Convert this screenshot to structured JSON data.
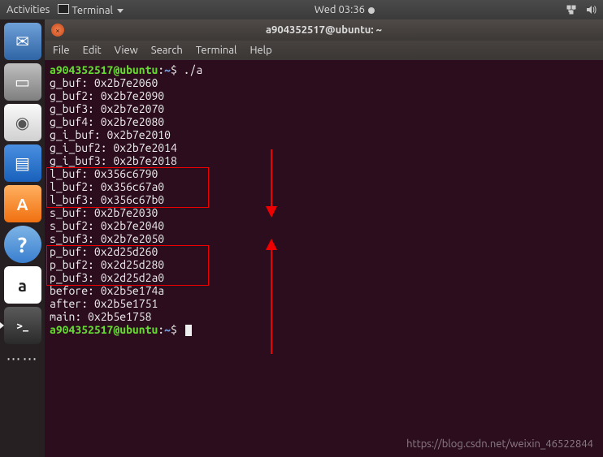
{
  "topbar": {
    "activities": "Activities",
    "app_label": "Terminal",
    "clock": "Wed 03:36"
  },
  "launcher": {
    "items": [
      {
        "name": "thunderbird-icon",
        "glyph": "✉"
      },
      {
        "name": "files-icon",
        "glyph": "▭"
      },
      {
        "name": "rhythmbox-icon",
        "glyph": "◉"
      },
      {
        "name": "libreoffice-writer-icon",
        "glyph": "▤"
      },
      {
        "name": "ubuntu-software-icon",
        "glyph": "A"
      },
      {
        "name": "help-icon",
        "glyph": "?"
      },
      {
        "name": "amazon-icon",
        "glyph": "a"
      },
      {
        "name": "terminal-icon",
        "glyph": ">_"
      }
    ]
  },
  "window": {
    "title": "a904352517@ubuntu: ~",
    "menus": [
      "File",
      "Edit",
      "View",
      "Search",
      "Terminal",
      "Help"
    ]
  },
  "prompt": {
    "user_host": "a904352517@ubuntu",
    "sep1": ":",
    "path": "~",
    "sep2": "$ "
  },
  "cmd": "./a",
  "output": [
    "g_buf: 0x2b7e2060",
    "g_buf2: 0x2b7e2090",
    "g_buf3: 0x2b7e2070",
    "g_buf4: 0x2b7e2080",
    "g_i_buf: 0x2b7e2010",
    "g_i_buf2: 0x2b7e2014",
    "g_i_buf3: 0x2b7e2018",
    "l_buf: 0x356c6790",
    "l_buf2: 0x356c67a0",
    "l_buf3: 0x356c67b0",
    "s_buf: 0x2b7e2030",
    "s_buf2: 0x2b7e2040",
    "s_buf3: 0x2b7e2050",
    "p_buf: 0x2d25d260",
    "p_buf2: 0x2d25d280",
    "p_buf3: 0x2d25d2a0",
    "before: 0x2b5e174a",
    "after: 0x2b5e1751",
    "main: 0x2b5e1758"
  ],
  "watermark": "https://blog.csdn.net/weixin_46522844"
}
